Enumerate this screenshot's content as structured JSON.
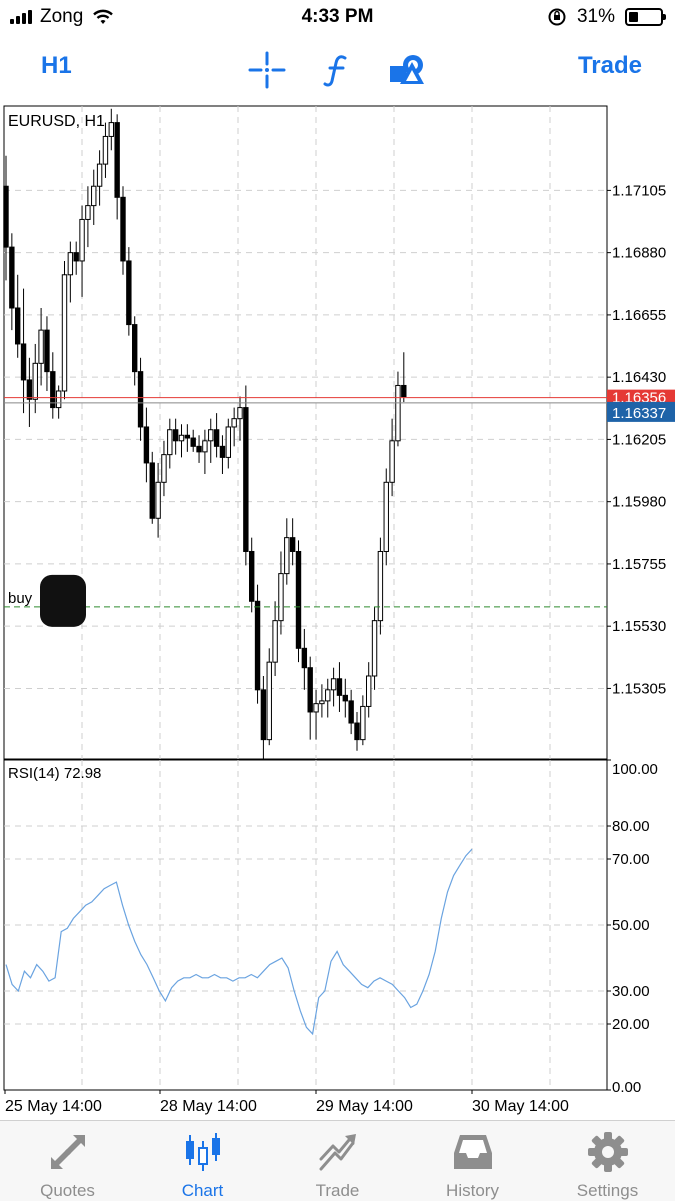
{
  "status_bar": {
    "carrier": "Zong",
    "time": "4:33 PM",
    "battery": "31%",
    "battery_level": 0.31
  },
  "toolbar": {
    "timeframe": "H1",
    "trade": "Trade",
    "icons": [
      "crosshair-icon",
      "function-icon",
      "objects-icon"
    ]
  },
  "chart_data": {
    "type": "candlestick",
    "symbol_label": "EURUSD, H1",
    "price_ticks": [
      "1.17105",
      "1.16880",
      "1.16655",
      "1.16430",
      "1.16205",
      "1.15980",
      "1.15755",
      "1.15530",
      "1.15305"
    ],
    "ylim": [
      1.1505,
      1.1741
    ],
    "bid_line": 1.16356,
    "ask_line": 1.16337,
    "current_price_label": "1.16337",
    "bid_price_label_partial": "1.16356",
    "order_line": {
      "label": "buy",
      "price": 1.156
    },
    "time_labels": [
      "25 May 14:00",
      "28 May 14:00",
      "29 May 14:00",
      "30 May 14:00"
    ],
    "grid": true,
    "candles": [
      [
        1.1712,
        1.1723,
        1.1678,
        1.169
      ],
      [
        1.169,
        1.1695,
        1.166,
        1.1668
      ],
      [
        1.1668,
        1.168,
        1.165,
        1.1655
      ],
      [
        1.1655,
        1.1675,
        1.163,
        1.1642
      ],
      [
        1.1642,
        1.165,
        1.1625,
        1.1635
      ],
      [
        1.1635,
        1.1655,
        1.163,
        1.1648
      ],
      [
        1.1648,
        1.1668,
        1.164,
        1.166
      ],
      [
        1.166,
        1.1665,
        1.1638,
        1.1645
      ],
      [
        1.1645,
        1.1652,
        1.1628,
        1.1632
      ],
      [
        1.1632,
        1.164,
        1.1628,
        1.1638
      ],
      [
        1.1638,
        1.1685,
        1.1635,
        1.168
      ],
      [
        1.168,
        1.1692,
        1.167,
        1.1688
      ],
      [
        1.1688,
        1.1692,
        1.168,
        1.1685
      ],
      [
        1.1685,
        1.1705,
        1.1672,
        1.17
      ],
      [
        1.17,
        1.1712,
        1.169,
        1.1705
      ],
      [
        1.1705,
        1.1718,
        1.1698,
        1.1712
      ],
      [
        1.1712,
        1.1725,
        1.1705,
        1.172
      ],
      [
        1.172,
        1.1735,
        1.1715,
        1.173
      ],
      [
        1.173,
        1.174,
        1.1725,
        1.1735
      ],
      [
        1.1735,
        1.1738,
        1.17,
        1.1708
      ],
      [
        1.1708,
        1.1712,
        1.168,
        1.1685
      ],
      [
        1.1685,
        1.169,
        1.1658,
        1.1662
      ],
      [
        1.1662,
        1.1665,
        1.164,
        1.1645
      ],
      [
        1.1645,
        1.165,
        1.162,
        1.1625
      ],
      [
        1.1625,
        1.1632,
        1.1605,
        1.1612
      ],
      [
        1.1612,
        1.1616,
        1.159,
        1.1592
      ],
      [
        1.1592,
        1.1612,
        1.1585,
        1.1605
      ],
      [
        1.1605,
        1.162,
        1.16,
        1.1615
      ],
      [
        1.1615,
        1.1628,
        1.161,
        1.1624
      ],
      [
        1.1624,
        1.1628,
        1.1615,
        1.162
      ],
      [
        1.162,
        1.1626,
        1.1614,
        1.1622
      ],
      [
        1.1622,
        1.1626,
        1.1616,
        1.1621
      ],
      [
        1.1621,
        1.1624,
        1.1616,
        1.1618
      ],
      [
        1.1618,
        1.1622,
        1.1612,
        1.1616
      ],
      [
        1.1616,
        1.1624,
        1.1608,
        1.162
      ],
      [
        1.162,
        1.1628,
        1.1612,
        1.1624
      ],
      [
        1.1624,
        1.163,
        1.1614,
        1.1618
      ],
      [
        1.1618,
        1.1622,
        1.1608,
        1.1614
      ],
      [
        1.1614,
        1.1628,
        1.161,
        1.1625
      ],
      [
        1.1625,
        1.1632,
        1.1618,
        1.1628
      ],
      [
        1.1628,
        1.1636,
        1.162,
        1.1632
      ],
      [
        1.1632,
        1.164,
        1.1575,
        1.158
      ],
      [
        1.158,
        1.1585,
        1.1558,
        1.1562
      ],
      [
        1.1562,
        1.1568,
        1.1525,
        1.153
      ],
      [
        1.153,
        1.1535,
        1.1505,
        1.1512
      ],
      [
        1.1512,
        1.1545,
        1.151,
        1.154
      ],
      [
        1.154,
        1.1562,
        1.1535,
        1.1555
      ],
      [
        1.1555,
        1.158,
        1.155,
        1.1572
      ],
      [
        1.1572,
        1.1592,
        1.1568,
        1.1585
      ],
      [
        1.1585,
        1.1592,
        1.1575,
        1.158
      ],
      [
        1.158,
        1.1584,
        1.154,
        1.1545
      ],
      [
        1.1545,
        1.1552,
        1.153,
        1.1538
      ],
      [
        1.1538,
        1.1542,
        1.1512,
        1.1522
      ],
      [
        1.1522,
        1.153,
        1.1512,
        1.1525
      ],
      [
        1.1525,
        1.1532,
        1.152,
        1.1526
      ],
      [
        1.1526,
        1.1534,
        1.152,
        1.153
      ],
      [
        1.153,
        1.1538,
        1.1524,
        1.1534
      ],
      [
        1.1534,
        1.154,
        1.1522,
        1.1528
      ],
      [
        1.1528,
        1.1534,
        1.152,
        1.1526
      ],
      [
        1.1526,
        1.153,
        1.1514,
        1.1518
      ],
      [
        1.1518,
        1.1522,
        1.1508,
        1.1512
      ],
      [
        1.1512,
        1.1528,
        1.151,
        1.1524
      ],
      [
        1.1524,
        1.154,
        1.152,
        1.1535
      ],
      [
        1.1535,
        1.156,
        1.153,
        1.1555
      ],
      [
        1.1555,
        1.1585,
        1.155,
        1.158
      ],
      [
        1.158,
        1.161,
        1.1575,
        1.1605
      ],
      [
        1.1605,
        1.1628,
        1.16,
        1.162
      ],
      [
        1.162,
        1.1645,
        1.1618,
        1.164
      ],
      [
        1.164,
        1.1652,
        1.1634,
        1.1636
      ]
    ],
    "rsi": {
      "label": "RSI(14) 72.98",
      "value": 72.98,
      "ticks": [
        "100.00",
        "80.00",
        "70.00",
        "50.00",
        "30.00",
        "20.00",
        "0.00"
      ],
      "ylim": [
        0,
        100
      ],
      "levels": [
        30,
        70
      ],
      "values": [
        38,
        32,
        30,
        36,
        34,
        38,
        36,
        33,
        34,
        48,
        49,
        52,
        54,
        56,
        57,
        59,
        61,
        62,
        63,
        56,
        50,
        45,
        41,
        38,
        34,
        30,
        27,
        31,
        33,
        34,
        34,
        35,
        34,
        34,
        35,
        34,
        34,
        33,
        34,
        34,
        35,
        34,
        36,
        38,
        39,
        40,
        37,
        30,
        24,
        19,
        17,
        28,
        30,
        39,
        42,
        38,
        36,
        34,
        32,
        31,
        33,
        34,
        33,
        32,
        30,
        28,
        25,
        26,
        30,
        35,
        42,
        52,
        60,
        65,
        68,
        71,
        73
      ]
    }
  },
  "tabs": [
    {
      "label": "Quotes",
      "icon": "quotes-icon",
      "active": false
    },
    {
      "label": "Chart",
      "icon": "chart-icon",
      "active": true
    },
    {
      "label": "Trade",
      "icon": "trade-icon",
      "active": false
    },
    {
      "label": "History",
      "icon": "history-icon",
      "active": false
    },
    {
      "label": "Settings",
      "icon": "gear-icon",
      "active": false
    }
  ],
  "colors": {
    "accent": "#1a74e8",
    "bid": "#e53935",
    "price_bg": "#1e63a8",
    "rsi_line": "#6aa3e0"
  }
}
